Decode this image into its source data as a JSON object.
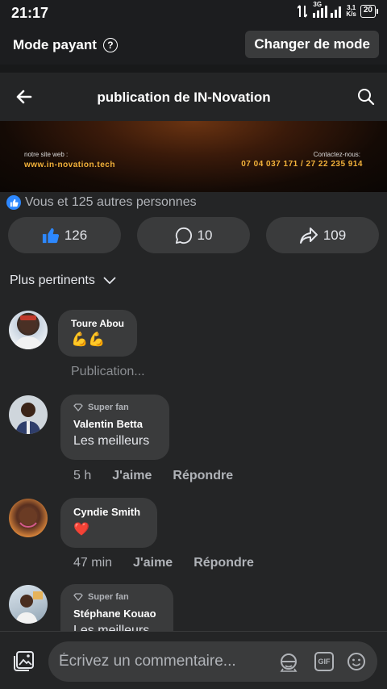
{
  "status_bar": {
    "time": "21:17",
    "network": "3G",
    "speed_value": "3,1",
    "speed_unit": "K/s",
    "battery": "20"
  },
  "mode_bar": {
    "label": "Mode payant",
    "help_icon": "?",
    "button": "Changer de mode"
  },
  "header": {
    "title": "publication de IN-Novation",
    "back_icon": "arrow-left-icon",
    "search_icon": "search-icon"
  },
  "banner": {
    "site_label": "notre site web :",
    "site_url": "www.in-novation.tech",
    "contact_label": "Contactez-nous:",
    "phones": "07 04 037 171 / 27 22 235 914"
  },
  "reactions": {
    "summary": "Vous et 125 autres personnes",
    "likes": "126",
    "comments": "10",
    "shares": "109"
  },
  "sort": {
    "label": "Plus pertinents"
  },
  "comments": [
    {
      "name": "Toure Abou",
      "text": "💪💪",
      "super_fan": false,
      "pending": "Publication..."
    },
    {
      "badge": "Super fan",
      "name": "Valentin Betta",
      "text": "Les meilleurs",
      "time": "5 h",
      "like": "J'aime",
      "reply": "Répondre"
    },
    {
      "name": "Cyndie Smith",
      "text": "❤️",
      "time": "47 min",
      "like": "J'aime",
      "reply": "Répondre"
    },
    {
      "badge": "Super fan",
      "name": "Stéphane Kouao",
      "text": "Les meilleurs"
    }
  ],
  "composer": {
    "placeholder": "Écrivez un commentaire...",
    "gif": "GIF"
  },
  "colors": {
    "background": "#242526",
    "bubble": "#3a3b3c",
    "accent": "#2d88ff",
    "banner_text": "#f3b23a"
  }
}
